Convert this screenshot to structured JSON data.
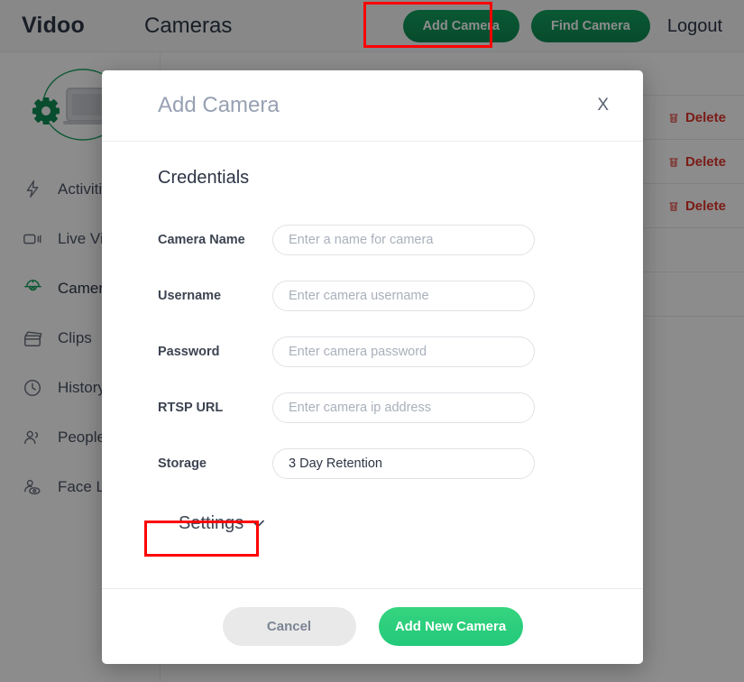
{
  "topbar": {
    "logo": "Vidoo",
    "page_heading": "Cameras",
    "add_camera_label": "Add Camera",
    "find_camera_label": "Find Camera",
    "logout_label": "Logout"
  },
  "sidebar": {
    "items": [
      {
        "label": "Activities",
        "icon": "bolt-icon",
        "active": false
      },
      {
        "label": "Live Video",
        "icon": "video-camera-icon",
        "active": false
      },
      {
        "label": "Cameras",
        "icon": "dome-camera-icon",
        "active": true
      },
      {
        "label": "Clips",
        "icon": "clapperboard-icon",
        "active": false
      },
      {
        "label": "History",
        "icon": "clock-icon",
        "active": false
      },
      {
        "label": "People",
        "icon": "people-icon",
        "active": false
      },
      {
        "label": "Face Lock",
        "icon": "face-eye-icon",
        "active": false
      }
    ]
  },
  "table": {
    "rows": [
      {
        "delete_label": "Delete"
      },
      {
        "delete_label": "Delete"
      },
      {
        "delete_label": "Delete"
      }
    ]
  },
  "modal": {
    "title": "Add Camera",
    "close_label": "X",
    "section_title": "Credentials",
    "fields": [
      {
        "label": "Camera Name",
        "placeholder": "Enter a name for camera",
        "value": ""
      },
      {
        "label": "Username",
        "placeholder": "Enter camera username",
        "value": ""
      },
      {
        "label": "Password",
        "placeholder": "Enter camera password",
        "value": ""
      },
      {
        "label": "RTSP URL",
        "placeholder": "Enter camera ip address",
        "value": ""
      },
      {
        "label": "Storage",
        "placeholder": "",
        "value": "3 Day Retention"
      }
    ],
    "settings_label": "Settings",
    "cancel_label": "Cancel",
    "submit_label": "Add New Camera"
  },
  "colors": {
    "brand_green": "#1aa362",
    "submit_green": "#22c97a",
    "delete_red": "#e0342b",
    "annotation_red": "#ff0000",
    "text_dark": "#2d3545",
    "muted": "#97a1b3"
  }
}
